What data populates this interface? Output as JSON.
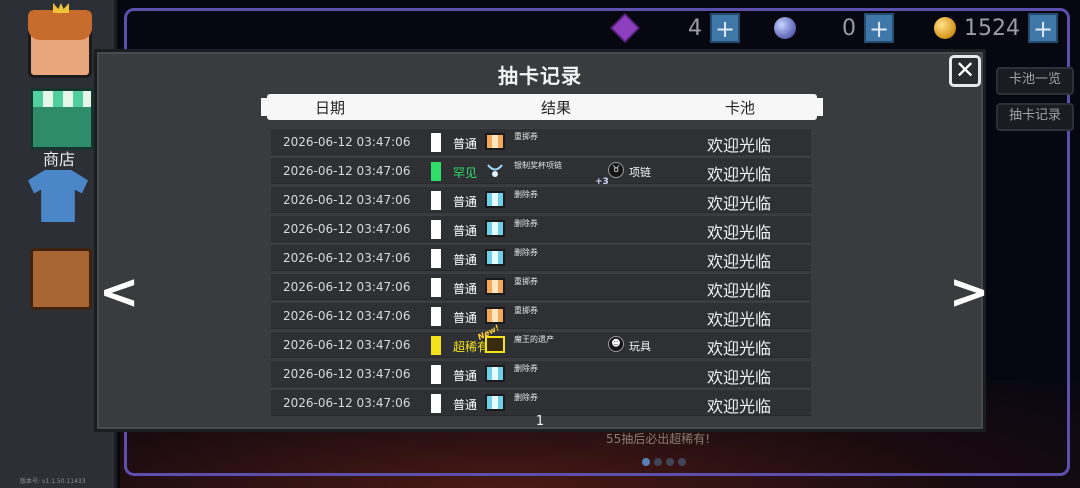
{
  "sidebar": {
    "shop_label": "商店",
    "version": "版本号: v1.1.50.11433"
  },
  "currencies": [
    {
      "icon": "gem-icon",
      "value": "4",
      "add": "+"
    },
    {
      "icon": "orb-icon",
      "value": "0",
      "add": "+"
    },
    {
      "icon": "coin-icon",
      "value": "1524",
      "add": "+"
    }
  ],
  "side_buttons": {
    "pool_list": "卡池一览",
    "draw_history": "抽卡记录"
  },
  "background": {
    "bottom_text": "55抽后必出超稀有!"
  },
  "dialog": {
    "title": "抽卡记录",
    "close_glyph": "✕",
    "prev_glyph": "<",
    "next_glyph": ">",
    "columns": {
      "date": "日期",
      "result": "结果",
      "pool": "卡池"
    },
    "page": "1",
    "rows": [
      {
        "date": "2026-06-12 03:47:06",
        "rarity": "普通",
        "rarity_color": "#ffffff",
        "label_color": "#ffffff",
        "item": "重掷券",
        "item_icon": "reroll-ticket-icon",
        "pool": "欢迎光临"
      },
      {
        "date": "2026-06-12 03:47:06",
        "rarity": "罕见",
        "rarity_color": "#2ee06a",
        "label_color": "#2ee06a",
        "item": "银制奖杯项链",
        "item_icon": "necklace-icon",
        "category": "项链",
        "bonus": "+3",
        "pool": "欢迎光临"
      },
      {
        "date": "2026-06-12 03:47:06",
        "rarity": "普通",
        "rarity_color": "#ffffff",
        "label_color": "#ffffff",
        "item": "删除券",
        "item_icon": "delete-ticket-icon",
        "pool": "欢迎光临"
      },
      {
        "date": "2026-06-12 03:47:06",
        "rarity": "普通",
        "rarity_color": "#ffffff",
        "label_color": "#ffffff",
        "item": "删除券",
        "item_icon": "delete-ticket-icon",
        "pool": "欢迎光临"
      },
      {
        "date": "2026-06-12 03:47:06",
        "rarity": "普通",
        "rarity_color": "#ffffff",
        "label_color": "#ffffff",
        "item": "删除券",
        "item_icon": "delete-ticket-icon",
        "pool": "欢迎光临"
      },
      {
        "date": "2026-06-12 03:47:06",
        "rarity": "普通",
        "rarity_color": "#ffffff",
        "label_color": "#ffffff",
        "item": "重掷券",
        "item_icon": "reroll-ticket-icon",
        "pool": "欢迎光临"
      },
      {
        "date": "2026-06-12 03:47:06",
        "rarity": "普通",
        "rarity_color": "#ffffff",
        "label_color": "#ffffff",
        "item": "重掷券",
        "item_icon": "reroll-ticket-icon",
        "pool": "欢迎光临"
      },
      {
        "date": "2026-06-12 03:47:06",
        "rarity": "超稀有",
        "rarity_color": "#f4e21a",
        "label_color": "#f4e21a",
        "item": "魔王的遗产",
        "item_icon": "treasure-chest-icon",
        "new_tag": "New!",
        "category": "玩具",
        "pool": "欢迎光临"
      },
      {
        "date": "2026-06-12 03:47:06",
        "rarity": "普通",
        "rarity_color": "#ffffff",
        "label_color": "#ffffff",
        "item": "删除券",
        "item_icon": "delete-ticket-icon",
        "pool": "欢迎光临"
      },
      {
        "date": "2026-06-12 03:47:06",
        "rarity": "普通",
        "rarity_color": "#ffffff",
        "label_color": "#ffffff",
        "item": "删除券",
        "item_icon": "delete-ticket-icon",
        "pool": "欢迎光临"
      }
    ]
  }
}
